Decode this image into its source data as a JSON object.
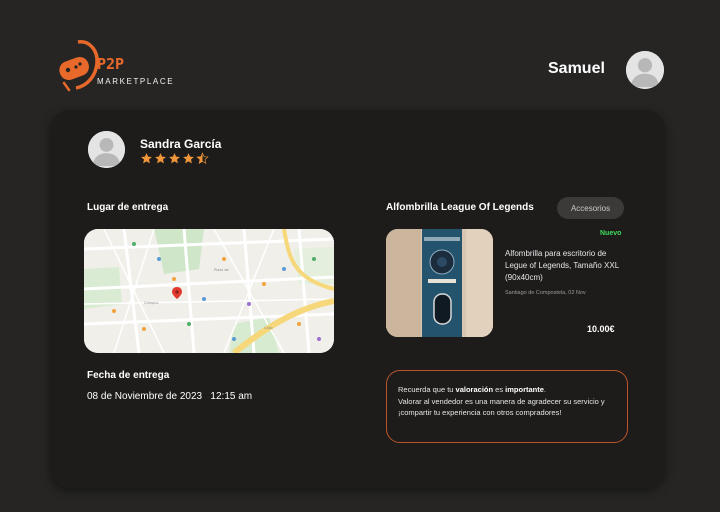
{
  "header": {
    "logo_top": "P2P",
    "logo_bottom": "MARKETPLACE",
    "user_name": "Samuel"
  },
  "seller": {
    "name": "Sandra García",
    "rating": 4.5
  },
  "delivery": {
    "place_label": "Lugar de entrega",
    "date_label": "Fecha de entrega",
    "date_value": "08 de Noviembre de 2023   12:15 am"
  },
  "product": {
    "title": "Alfombrilla League Of Legends",
    "category": "Accesorios",
    "condition": "Nuevo",
    "description": "Alfombrilla para escritorio de Legue of Legends, Tamaño XXL (90x40cm)",
    "location_date": "Santiago de Compostela, 02 Nov",
    "price": "10.00€"
  },
  "notice": {
    "part1": "Recuerda que tu ",
    "bold1": "valoración",
    "part2": " es ",
    "bold2": "importante",
    "part3": ".",
    "line2": "Valorar al vendedor es una manera de agradecer su servicio y ¡compartir tu experiencia con otros compradores!"
  },
  "colors": {
    "background": "#262524",
    "card": "#1d1c1b",
    "accent": "#e8692a",
    "star": "#f0953a",
    "new_badge": "#3ddc5a",
    "notice_border": "#b8552a"
  },
  "icons": [
    "gamepad-logo-icon",
    "user-avatar-icon",
    "star-icon",
    "map-pin-icon"
  ]
}
